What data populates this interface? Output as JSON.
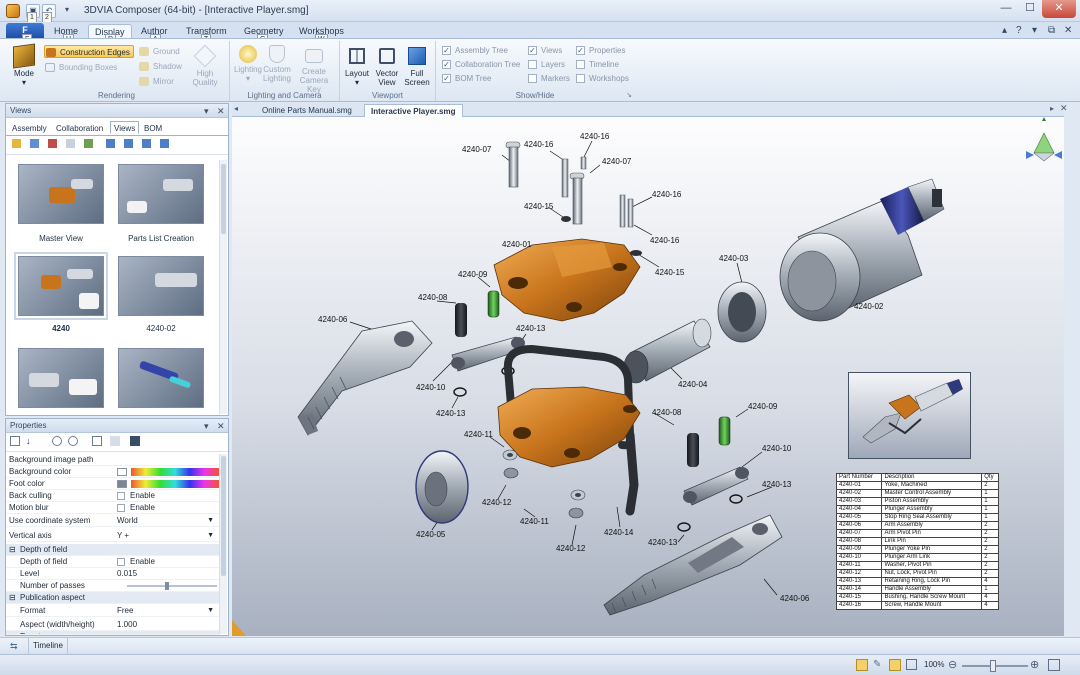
{
  "window": {
    "title": "3DVIA Composer (64-bit) - [Interactive Player.smg]",
    "minimize": "—",
    "maximize": "☐",
    "close": "✕"
  },
  "quick_access": {
    "keytip_1": "1",
    "keytip_2": "2"
  },
  "ribbon": {
    "file_tab": "F",
    "file_keytip": "F",
    "tabs": [
      {
        "label": "Home",
        "keytip": "H"
      },
      {
        "label": "Display",
        "keytip": "D"
      },
      {
        "label": "Author",
        "keytip": "A"
      },
      {
        "label": "Transform",
        "keytip": "T"
      },
      {
        "label": "Geometry",
        "keytip": "G"
      },
      {
        "label": "Workshops",
        "keytip": "W"
      }
    ],
    "help": "?",
    "groups": {
      "rendering": {
        "label": "Rendering",
        "mode": "Mode",
        "construction_edges": "Construction Edges",
        "bounding_boxes": "Bounding Boxes",
        "ground": "Ground",
        "shadow": "Shadow",
        "mirror": "Mirror",
        "high_quality": "High Quality"
      },
      "lighting": {
        "label": "Lighting and Camera",
        "lighting": "Lighting",
        "custom_lighting": "Custom Lighting",
        "create_camera_key": "Create Camera Key"
      },
      "viewport": {
        "label": "Viewport",
        "layout": "Layout",
        "vector_view": "Vector View",
        "full_screen": "Full Screen"
      },
      "show_hide": {
        "label": "Show/Hide",
        "assembly_tree": "Assembly Tree",
        "collaboration_tree": "Collaboration Tree",
        "bom_tree": "BOM Tree",
        "views": "Views",
        "layers": "Layers",
        "markers": "Markers",
        "properties": "Properties",
        "timeline": "Timeline",
        "workshops": "Workshops"
      }
    }
  },
  "views_panel": {
    "title": "Views",
    "tabs": [
      "Assembly",
      "Collaboration",
      "Views",
      "BOM"
    ],
    "active_tab": "Views",
    "thumbnails": [
      "Master View",
      "Parts List Creation",
      "4240",
      "4240-02",
      "",
      ""
    ]
  },
  "properties_panel": {
    "title": "Properties",
    "rows": [
      {
        "key": "Background image path",
        "value": ""
      },
      {
        "key": "Background color",
        "value": ""
      },
      {
        "key": "Foot color",
        "value": ""
      },
      {
        "key": "Back culling",
        "value": "Enable"
      },
      {
        "key": "Motion blur",
        "value": "Enable"
      },
      {
        "key": "Use coordinate system",
        "value": "World"
      },
      {
        "key": "Vertical axis",
        "value": "Y +"
      },
      {
        "key": "Depth of field",
        "value": ""
      },
      {
        "key": "Depth of field",
        "value": "Enable"
      },
      {
        "key": "Level",
        "value": "0.015"
      },
      {
        "key": "Number of passes",
        "value": ""
      },
      {
        "key": "Publication aspect",
        "value": ""
      },
      {
        "key": "Format",
        "value": "Free"
      },
      {
        "key": "Aspect (width/height)",
        "value": "1.000"
      },
      {
        "key": "Event",
        "value": ""
      }
    ]
  },
  "documents": {
    "tabs": [
      "Online Parts Manual.smg",
      "Interactive Player.smg"
    ],
    "active": "Interactive Player.smg"
  },
  "viewport": {
    "callouts": [
      "4240-07",
      "4240-16",
      "4240-16",
      "4240-07",
      "4240-15",
      "4240-16",
      "4240-16",
      "4240-15",
      "4240-01",
      "4240-09",
      "4240-03",
      "4240-02",
      "4240-08",
      "4240-06",
      "4240-13",
      "4240-10",
      "4240-13",
      "4240-04",
      "4240-08",
      "4240-09",
      "4240-11",
      "4240-10",
      "4240-12",
      "4240-13",
      "4240-11",
      "4240-05",
      "4240-12",
      "4240-14",
      "4240-13",
      "4240-06"
    ]
  },
  "bom_table": {
    "headers": [
      "Part Number",
      "Description",
      "Qty"
    ],
    "rows": [
      [
        "4240-01",
        "Yoke, Machined",
        "2"
      ],
      [
        "4240-02",
        "Master Control Assembly",
        "1"
      ],
      [
        "4240-03",
        "Piston Assembly",
        "1"
      ],
      [
        "4240-04",
        "Plunger Assembly",
        "1"
      ],
      [
        "4240-05",
        "Stop Ring Seal Assembly",
        "1"
      ],
      [
        "4240-06",
        "Arm Assembly",
        "2"
      ],
      [
        "4240-07",
        "Arm Pivot Pin",
        "2"
      ],
      [
        "4240-08",
        "Link Pin",
        "2"
      ],
      [
        "4240-09",
        "Plunger Yoke Pin",
        "2"
      ],
      [
        "4240-10",
        "Plunger Arm Link",
        "2"
      ],
      [
        "4240-11",
        "Washer, Pivot Pin",
        "2"
      ],
      [
        "4240-12",
        "Nut, Lock, Pivot Pin",
        "2"
      ],
      [
        "4240-13",
        "Retaining Ring, Lock Pin",
        "4"
      ],
      [
        "4240-14",
        "Handle Assembly",
        "1"
      ],
      [
        "4240-15",
        "Bushing, Handle Screw Mount",
        "4"
      ],
      [
        "4240-16",
        "Screw, Handle Mount",
        "4"
      ]
    ]
  },
  "timeline_bar": {
    "label": "Timeline"
  },
  "statusbar": {
    "zoom": "100%"
  },
  "colors": {
    "accent": "#1f4fa5",
    "part_orange": "#c8741c",
    "part_steel": "#9aa2ad",
    "part_dark": "#2f3238"
  }
}
